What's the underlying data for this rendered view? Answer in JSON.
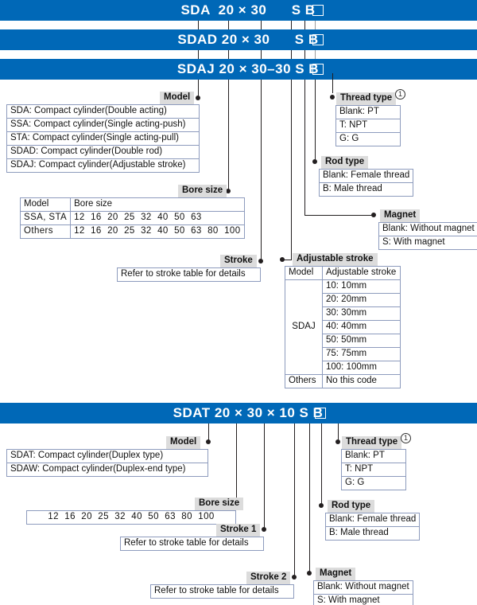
{
  "section1": {
    "codebars": [
      {
        "text": "SDA  20 × 30      S B",
        "has_box": true
      },
      {
        "text": "SDAD 20 × 30      S B",
        "has_box": true
      },
      {
        "text": "SDAJ 20 × 30–30 S B",
        "has_box": true
      }
    ],
    "model": {
      "label": "Model",
      "rows": [
        "SDA: Compact cylinder(Double acting)",
        "SSA: Compact cylinder(Single acting-push)",
        "STA: Compact cylinder(Single acting-pull)",
        "SDAD: Compact cylinder(Double rod)",
        "SDAJ: Compact cylinder(Adjustable stroke)"
      ]
    },
    "bore_size": {
      "label": "Bore size",
      "header": [
        "Model",
        "Bore size"
      ],
      "rows": [
        {
          "model": "SSA, STA",
          "sizes": [
            "12",
            "16",
            "20",
            "25",
            "32",
            "40",
            "50",
            "63"
          ]
        },
        {
          "model": "Others",
          "sizes": [
            "12",
            "16",
            "20",
            "25",
            "32",
            "40",
            "50",
            "63",
            "80",
            "100"
          ]
        }
      ]
    },
    "stroke": {
      "label": "Stroke",
      "value": "Refer to stroke table for details"
    },
    "adjustable_stroke": {
      "label": "Adjustable stroke",
      "header": [
        "Model",
        "Adjustable stroke"
      ],
      "model_name": "SDAJ",
      "values": [
        "10: 10mm",
        "20: 20mm",
        "30: 30mm",
        "40: 40mm",
        "50: 50mm",
        "75: 75mm",
        "100: 100mm"
      ],
      "others_label": "Others",
      "others_value": "No this code"
    },
    "thread_type": {
      "label": "Thread type",
      "note": "1",
      "rows": [
        "Blank: PT",
        "T: NPT",
        "G: G"
      ]
    },
    "rod_type": {
      "label": "Rod type",
      "rows": [
        "Blank: Female thread",
        "B: Male thread"
      ]
    },
    "magnet": {
      "label": "Magnet",
      "rows": [
        "Blank: Without magnet",
        "S: With magnet"
      ]
    }
  },
  "section2": {
    "codebar": {
      "text": "SDAT 20 × 30 × 10 S B",
      "has_box": true
    },
    "model": {
      "label": "Model",
      "rows": [
        "SDAT: Compact cylinder(Duplex type)",
        "SDAW: Compact cylinder(Duplex-end type)"
      ]
    },
    "bore_size": {
      "label": "Bore size",
      "sizes": [
        "12",
        "16",
        "20",
        "25",
        "32",
        "40",
        "50",
        "63",
        "80",
        "100"
      ]
    },
    "stroke1": {
      "label": "Stroke 1",
      "value": "Refer to stroke table for details"
    },
    "stroke2": {
      "label": "Stroke 2",
      "value": "Refer to stroke table for details"
    },
    "thread_type": {
      "label": "Thread type",
      "note": "1",
      "rows": [
        "Blank: PT",
        "T: NPT",
        "G: G"
      ]
    },
    "rod_type": {
      "label": "Rod type",
      "rows": [
        "Blank: Female thread",
        "B: Male thread"
      ]
    },
    "magnet": {
      "label": "Magnet",
      "rows": [
        "Blank: Without magnet",
        "S: With magnet"
      ]
    }
  },
  "colors": {
    "bar_blue": "#0068b7",
    "label_gray": "#dcdcdc",
    "table_border": "#8d9bbd"
  }
}
